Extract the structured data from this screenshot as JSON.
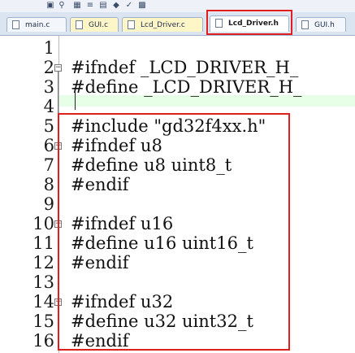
{
  "toolbar": {
    "icons": [
      "toolbar-icon-1",
      "toolbar-icon-2",
      "toolbar-icon-3",
      "toolbar-icon-4",
      "toolbar-icon-5",
      "toolbar-icon-6",
      "toolbar-icon-7",
      "toolbar-icon-8"
    ]
  },
  "tabs": [
    {
      "label": "main.c",
      "state": "inactive"
    },
    {
      "label": "GUI.c",
      "state": "yellow"
    },
    {
      "label": "Lcd_Driver.c",
      "state": "yellow"
    },
    {
      "label": "Lcd_Driver.h",
      "state": "active"
    },
    {
      "label": "GUI.h",
      "state": "inactive"
    }
  ],
  "colors": {
    "highlight": "#e01e1e",
    "active_tab_text": "#b00000"
  },
  "editor": {
    "lines": [
      {
        "num": "1",
        "text": ""
      },
      {
        "num": "2",
        "text": "#ifndef _LCD_DRIVER_H_"
      },
      {
        "num": "3",
        "text": "#define _LCD_DRIVER_H_"
      },
      {
        "num": "4",
        "text": ""
      },
      {
        "num": "5",
        "text": "#include \"gd32f4xx.h\""
      },
      {
        "num": "6",
        "text": "#ifndef u8"
      },
      {
        "num": "7",
        "text": "#define u8 uint8_t"
      },
      {
        "num": "8",
        "text": "#endif"
      },
      {
        "num": "9",
        "text": ""
      },
      {
        "num": "10",
        "text": "#ifndef u16"
      },
      {
        "num": "11",
        "text": "#define u16 uint16_t"
      },
      {
        "num": "12",
        "text": "#endif"
      },
      {
        "num": "13",
        "text": ""
      },
      {
        "num": "14",
        "text": "#ifndef u32"
      },
      {
        "num": "15",
        "text": "#define u32 uint32_t"
      },
      {
        "num": "16",
        "text": "#endif"
      }
    ]
  }
}
